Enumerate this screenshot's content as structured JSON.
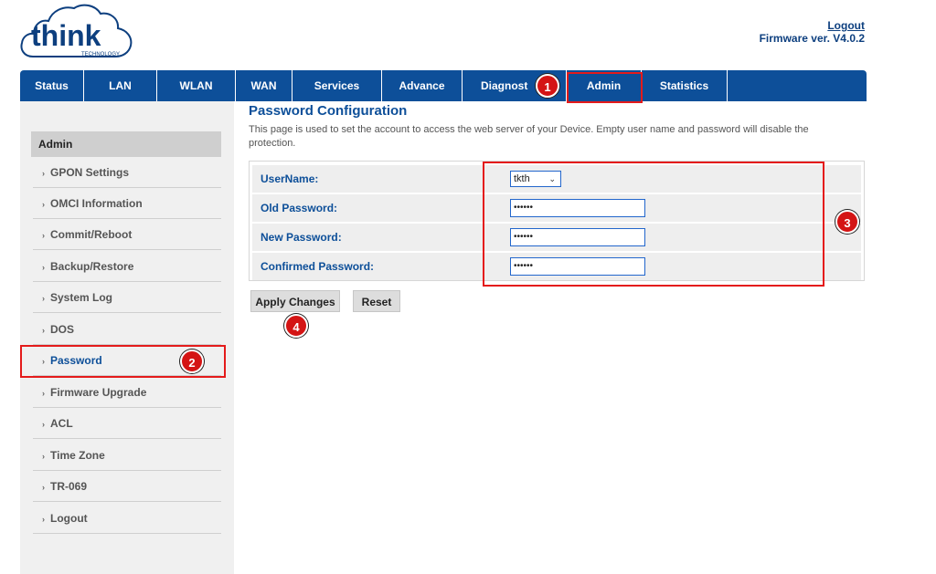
{
  "header": {
    "logo_text": "think",
    "logo_sub": "TECHNOLOGY",
    "logout_label": "Logout",
    "firmware": "Firmware ver. V4.0.2"
  },
  "nav": {
    "tabs": [
      {
        "label": "Status"
      },
      {
        "label": "LAN"
      },
      {
        "label": "WLAN"
      },
      {
        "label": "WAN"
      },
      {
        "label": "Services"
      },
      {
        "label": "Advance"
      },
      {
        "label": "Diagnost"
      },
      {
        "label": "Admin"
      },
      {
        "label": "Statistics"
      }
    ],
    "active": "Admin"
  },
  "sidebar": {
    "heading": "Admin",
    "items": [
      {
        "label": "GPON Settings"
      },
      {
        "label": "OMCI Information"
      },
      {
        "label": "Commit/Reboot"
      },
      {
        "label": "Backup/Restore"
      },
      {
        "label": "System Log"
      },
      {
        "label": "DOS"
      },
      {
        "label": "Password"
      },
      {
        "label": "Firmware Upgrade"
      },
      {
        "label": "ACL"
      },
      {
        "label": "Time Zone"
      },
      {
        "label": "TR-069"
      },
      {
        "label": "Logout"
      }
    ],
    "active": "Password"
  },
  "main": {
    "title": "Password Configuration",
    "description": "This page is used to set the account to access the web server of your Device. Empty user name and password will disable the protection.",
    "fields": [
      {
        "label": "UserName:",
        "type": "select",
        "value": "tkth"
      },
      {
        "label": "Old Password:",
        "type": "password",
        "value": "••••••"
      },
      {
        "label": "New Password:",
        "type": "password",
        "value": "••••••"
      },
      {
        "label": "Confirmed Password:",
        "type": "password",
        "value": "••••••"
      }
    ],
    "apply_label": "Apply Changes",
    "reset_label": "Reset"
  },
  "annotations": {
    "markers": [
      "1",
      "2",
      "3",
      "4"
    ],
    "color": "#e41b1b"
  },
  "colors": {
    "nav_blue": "#0d4f99",
    "accent_red": "#d41414"
  }
}
